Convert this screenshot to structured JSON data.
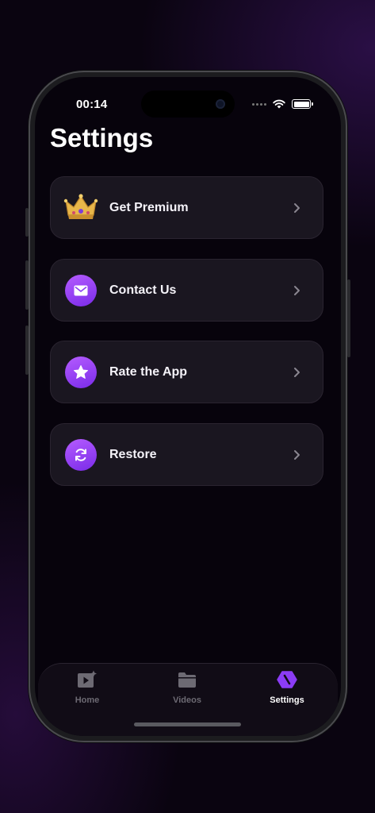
{
  "status_bar": {
    "time": "00:14"
  },
  "page": {
    "title": "Settings"
  },
  "menu": [
    {
      "label": "Get Premium",
      "icon": "crown-icon"
    },
    {
      "label": "Contact Us",
      "icon": "mail-icon"
    },
    {
      "label": "Rate the App",
      "icon": "star-icon"
    },
    {
      "label": "Restore",
      "icon": "refresh-icon"
    }
  ],
  "tabs": [
    {
      "label": "Home",
      "icon": "video-sparkle-icon",
      "active": false
    },
    {
      "label": "Videos",
      "icon": "folder-icon",
      "active": false
    },
    {
      "label": "Settings",
      "icon": "settings-hex-icon",
      "active": true
    }
  ],
  "colors": {
    "accent": "#8b3cf5",
    "card_bg": "#1a1620",
    "background": "#07030c"
  }
}
